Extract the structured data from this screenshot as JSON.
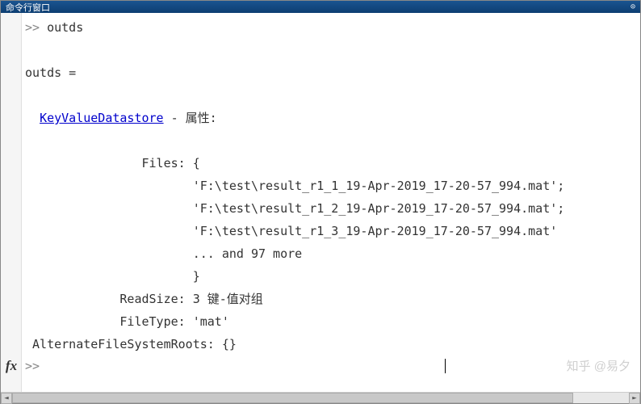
{
  "window": {
    "title": "命令行窗口"
  },
  "console": {
    "prompt_sym": ">>",
    "last_command": "outds",
    "var_echo": "outds =",
    "link_text": "KeyValueDatastore",
    "props_suffix": " - 属性:",
    "prop_files_label": "Files:",
    "brace_open": "{",
    "file1": "'F:\\test\\result_r1_1_19-Apr-2019_17-20-57_994.mat';",
    "file2": "'F:\\test\\result_r1_2_19-Apr-2019_17-20-57_994.mat';",
    "file3": "'F:\\test\\result_r1_3_19-Apr-2019_17-20-57_994.mat'",
    "more_line": "... and 97 more",
    "brace_close": "}",
    "prop_readsize_row": "             ReadSize: 3 键-值对组",
    "prop_filetype_row": "             FileType: 'mat'",
    "prop_altroots_row": " AlternateFileSystemRoots: {}",
    "files_label_pad": "                Files: ",
    "value_indent": "                       "
  },
  "fx": {
    "label": "fx",
    "prompt": ">> ",
    "value": ""
  },
  "watermark": "知乎 @易夕"
}
